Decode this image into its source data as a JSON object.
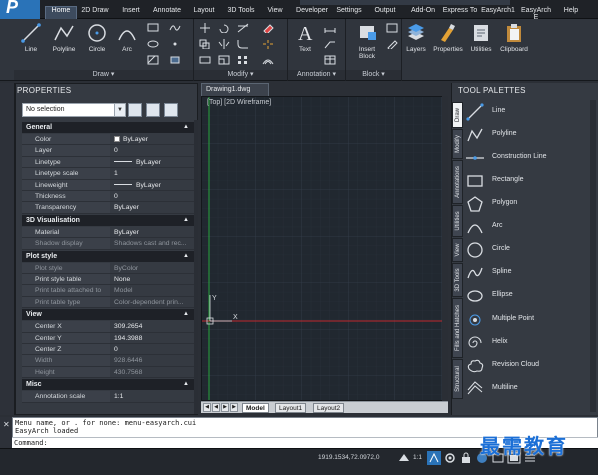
{
  "ribbon": {
    "tabs": [
      "Home",
      "2D Draw",
      "Insert",
      "Annotate",
      "Layout",
      "3D Tools",
      "View",
      "Developer",
      "Settings",
      "Output",
      "Add-On",
      "Express To",
      "EasyArch1",
      "EasyArch E",
      "Help"
    ],
    "active_tab": "Home",
    "draw_tools": [
      "Line",
      "Polyline",
      "Circle",
      "Arc"
    ],
    "text_tool": "Text",
    "insert_block": "Insert\nBlock",
    "right_tools": [
      "Layers",
      "Properties",
      "Utilities",
      "Clipboard"
    ],
    "groups": [
      "Draw",
      "Modify",
      "Annotation",
      "Block"
    ]
  },
  "properties": {
    "title": "PROPERTIES",
    "selection": "No selection",
    "sections": [
      {
        "name": "General",
        "rows": [
          {
            "key": "Color",
            "value": "ByLayer"
          },
          {
            "key": "Layer",
            "value": "0"
          },
          {
            "key": "Linetype",
            "value": "ByLayer"
          },
          {
            "key": "Linetype scale",
            "value": "1"
          },
          {
            "key": "Lineweight",
            "value": "ByLayer"
          },
          {
            "key": "Thickness",
            "value": "0"
          },
          {
            "key": "Transparency",
            "value": "ByLayer"
          }
        ]
      },
      {
        "name": "3D Visualisation",
        "rows": [
          {
            "key": "Material",
            "value": "ByLayer"
          },
          {
            "key": "Shadow display",
            "value": "Shadows cast and rec..."
          }
        ]
      },
      {
        "name": "Plot style",
        "rows": [
          {
            "key": "Plot style",
            "value": "ByColor"
          },
          {
            "key": "Print style table",
            "value": "None"
          },
          {
            "key": "Print table attached to",
            "value": "Model"
          },
          {
            "key": "Print table type",
            "value": "Color-dependent prin..."
          }
        ]
      },
      {
        "name": "View",
        "rows": [
          {
            "key": "Center X",
            "value": "309.2654"
          },
          {
            "key": "Center Y",
            "value": "194.3988"
          },
          {
            "key": "Center Z",
            "value": "0"
          },
          {
            "key": "Width",
            "value": "928.6446"
          },
          {
            "key": "Height",
            "value": "430.7568"
          }
        ]
      },
      {
        "name": "Misc",
        "rows": [
          {
            "key": "Annotation scale",
            "value": "1:1"
          }
        ]
      }
    ]
  },
  "drawing": {
    "tab": "Drawing1.dwg",
    "viewport_label": "[Top] [2D Wireframe]",
    "axis_x": "X",
    "axis_y": "Y",
    "layout_tabs": [
      "Model",
      "Layout1",
      "Layout2"
    ],
    "active_layout": "Model"
  },
  "tool_palettes": {
    "title": "TOOL PALETTES",
    "side_tabs": [
      "Draw",
      "Modify",
      "Annotations",
      "Utilities",
      "View",
      "3D Tools",
      "Fills and Hatches",
      "Structural"
    ],
    "active_side_tab": "Draw",
    "items": [
      "Line",
      "Polyline",
      "Construction Line",
      "Rectangle",
      "Polygon",
      "Arc",
      "Circle",
      "Spline",
      "Ellipse",
      "Multiple Point",
      "Helix",
      "Revision Cloud",
      "Multiline"
    ]
  },
  "command": {
    "history": [
      "Menu name, or . for none: menu-easyarch.cui",
      "EasyArch loaded"
    ],
    "prompt": "Command:"
  },
  "status": {
    "coordinates": "1919.1534,72.0972,0",
    "scale": "1:1"
  },
  "watermark": "最需教育",
  "colors": {
    "accent": "#2a73b8",
    "background": "#212830",
    "x_axis": "#c0272d",
    "y_axis": "#27a33d"
  }
}
